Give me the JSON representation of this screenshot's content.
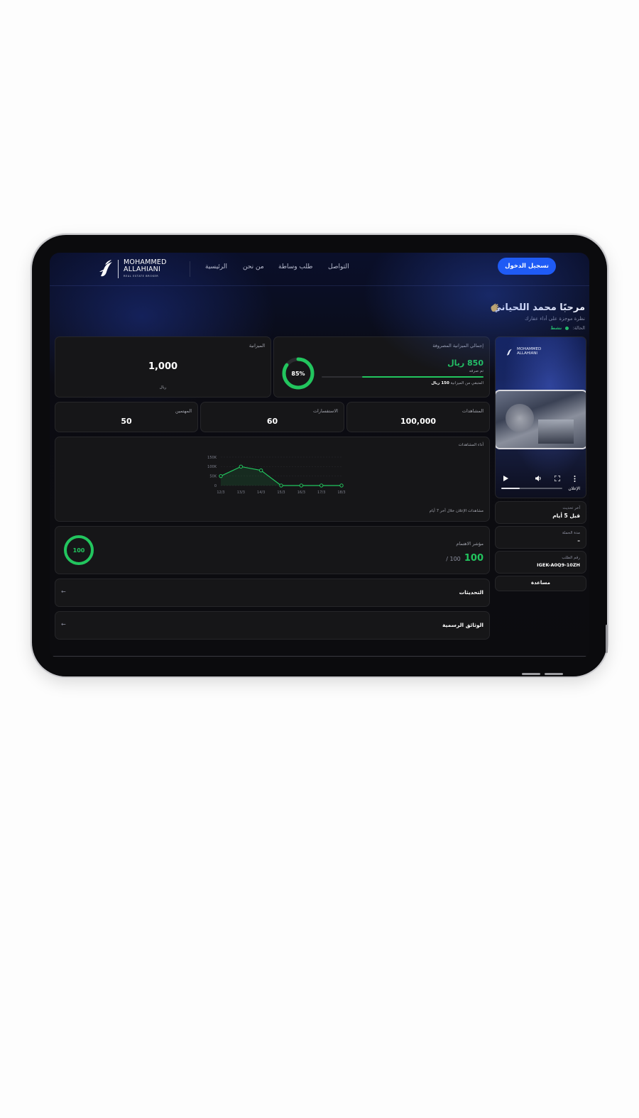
{
  "nav": {
    "logo_line1": "MOHAMMED",
    "logo_line2": "ALLAHIANI",
    "logo_sub": "REAL ESTATE BROKER",
    "links": [
      "التواصل",
      "طلب وساطة",
      "من نحن",
      "الرئيسية"
    ],
    "login": "تسجيل الدخول"
  },
  "header": {
    "title": "مرحبًا محمد اللحياني",
    "subtitle": "نظرة موجزة على أداء عقارك",
    "status_label": "الحالة:",
    "status_value": "نشط"
  },
  "budget": {
    "spent_label": "إجمالي الميزانية المصروفة",
    "spent_value": "850 ريال",
    "spent_note": "تم صرفه",
    "remaining_label": "المتبقي من الميزانية",
    "remaining_value": "150 ريال",
    "percent_text": "85%",
    "percent": 0.85,
    "total_label": "الميزانية",
    "total_value": "1,000",
    "total_unit": "ريال"
  },
  "stats": [
    {
      "label": "المشاهدات",
      "value": "100,000"
    },
    {
      "label": "الاستفسارات",
      "value": "60"
    },
    {
      "label": "المهتمين",
      "value": "50"
    }
  ],
  "chart": {
    "label": "أداء المشاهدات",
    "footer": "مشاهدات الإعلان خلال آخر 7 أيام"
  },
  "chart_data": {
    "type": "line",
    "title": "أداء المشاهدات",
    "x": [
      "12/3",
      "13/3",
      "14/3",
      "15/3",
      "16/3",
      "17/3",
      "18/3"
    ],
    "series": [
      {
        "values": [
          50000,
          100000,
          80000,
          0,
          0,
          0,
          0
        ]
      }
    ],
    "ytick_labels": [
      "0",
      "50K",
      "100K",
      "150K"
    ],
    "ylim": [
      0,
      150000
    ],
    "grid": true
  },
  "interest": {
    "label": "مؤشر الاهتمام",
    "value": "100",
    "max": "/ 100",
    "ring_text": "100",
    "ring_fraction": 1.0
  },
  "sections": [
    {
      "label": "التحديثات",
      "arrow": "←"
    },
    {
      "label": "الوثائق الرسمية",
      "arrow": "←"
    }
  ],
  "sidebar": {
    "video_label": "الإعلان",
    "video_logo_line1": "MOHAMMED",
    "video_logo_line2": "ALLAHIANI",
    "video_progress": 0.3,
    "last_update_label": "آخر تحديث",
    "last_update_value": "قبل 5 أيام",
    "campaign_label": "مدة الحملة",
    "campaign_value": "–",
    "order_label": "رقم الطلب",
    "order_value": "IGEK-A0Q9-10ZH",
    "help": "مساعدة"
  },
  "colors": {
    "accent": "#1f5bf5",
    "positive": "#22c55e",
    "card": "#161618"
  }
}
